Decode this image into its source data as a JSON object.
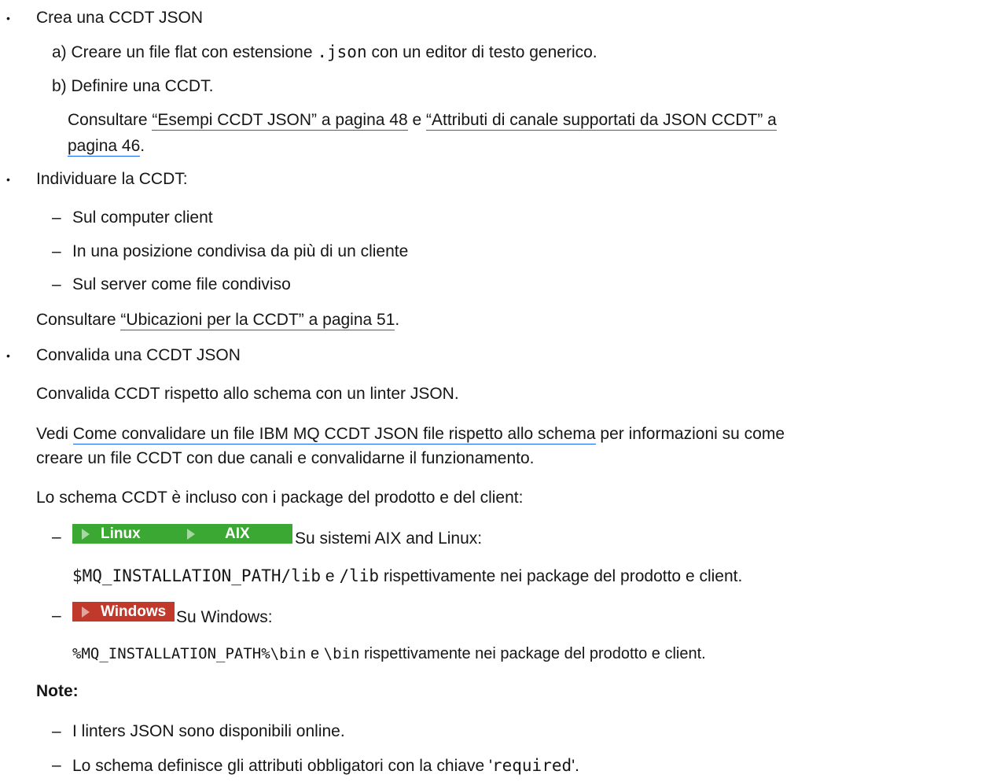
{
  "item1": {
    "title": "Crea una CCDT JSON",
    "step_a": "a) Creare un file flat con estensione",
    "step_a_code": ".json",
    "step_a_tail": "con un editor di testo generico.",
    "step_b": "b) Definire una CCDT.",
    "consult_prefix": "Consultare",
    "link1": "“Esempi CCDT JSON” a pagina 48",
    "and": "e",
    "link2_part1": "“Attributi di canale supportati da JSON CCDT” a",
    "link2_part2": "pagina 46",
    "period": "."
  },
  "item2": {
    "title": "Individuare la CCDT:",
    "options": [
      "Sul computer client",
      "In una posizione condivisa da più di un cliente",
      "Sul server come file condiviso"
    ],
    "consult_prefix": "Consultare",
    "link": "“Ubicazioni per la CCDT” a pagina 51",
    "period": "."
  },
  "item3": {
    "title": "Convalida una CCDT JSON",
    "desc": "Convalida CCDT rispetto allo schema con un linter JSON.",
    "see_prefix": "Vedi",
    "see_link": "Come convalidare un file IBM MQ CCDT JSON file rispetto allo schema",
    "see_tail": "per informazioni su come",
    "see_line2": "creare un file CCDT con due canali e convalidarne il funzionamento.",
    "schema_intro": "Lo schema CCDT è incluso con i package del prodotto e del client:",
    "linux_badge": "Linux",
    "aix_badge": "AIX",
    "unix_label": "Su sistemi AIX and Linux:",
    "unix_path": "$MQ_INSTALLATION_PATH/lib",
    "unix_e": "e",
    "unix_lib": "/lib",
    "unix_tail": "rispettivamente nei package del prodotto e client.",
    "windows_badge": "Windows",
    "windows_label": "Su Windows:",
    "win_path": "%MQ_INSTALLATION_PATH%\\bin",
    "win_e": "e",
    "win_bin": "\\bin",
    "win_tail": "rispettivamente nei package del prodotto e client.",
    "notes_title": "Note:",
    "note1": "I linters JSON sono disponibili online.",
    "note2_prefix": "Lo schema definisce gli attributi obbligatori con la chiave '",
    "note2_code": "required",
    "note2_suffix": "'."
  },
  "colors": {
    "link_underline": "#0f62fe",
    "linux_badge": "#3aa832",
    "windows_badge": "#c0392b"
  }
}
